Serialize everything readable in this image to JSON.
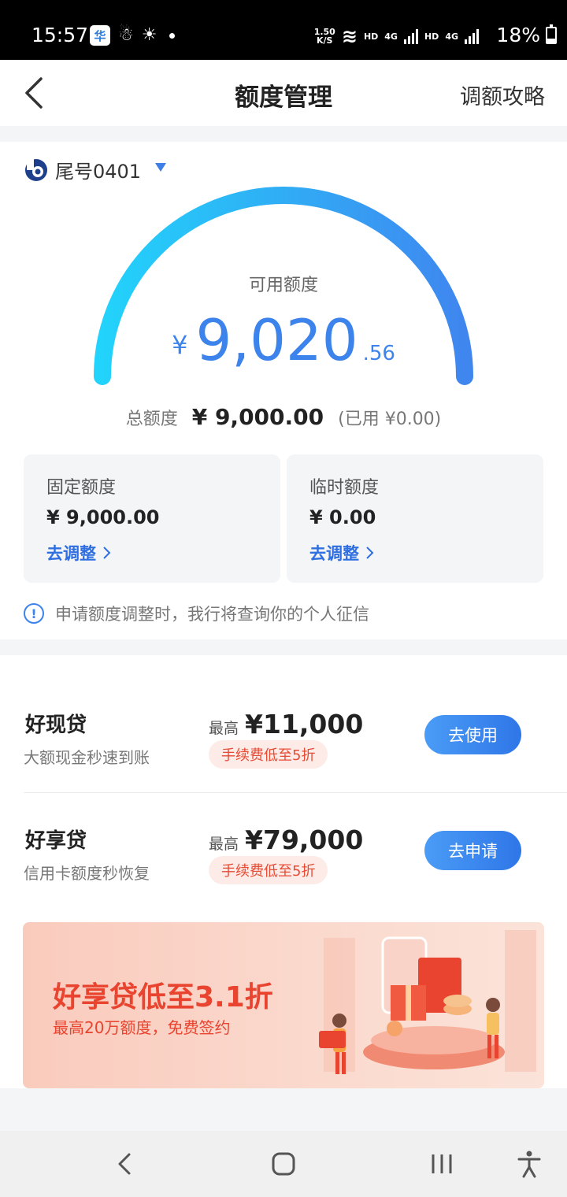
{
  "status_bar": {
    "time": "15:57",
    "app_icon_text": "华",
    "net_speed_top": "1.50",
    "net_speed_bottom": "K/S",
    "hd1": "HD",
    "net1": "4G",
    "hd2": "HD",
    "net2": "4G",
    "battery": "18%"
  },
  "header": {
    "title": "额度管理",
    "right_link": "调额攻略"
  },
  "account": {
    "label": "尾号0401"
  },
  "gauge": {
    "available_label": "可用额度",
    "currency": "¥",
    "amount_int": "9,020",
    "amount_dec": ".56",
    "colors": {
      "start": "#22d3fb",
      "end": "#3f86ef"
    }
  },
  "total": {
    "label": "总额度",
    "value": "¥ 9,000.00",
    "used": "(已用 ¥0.00)"
  },
  "quota_boxes": [
    {
      "label": "固定额度",
      "value": "¥ 9,000.00",
      "link": "去调整"
    },
    {
      "label": "临时额度",
      "value": "¥ 0.00",
      "link": "去调整"
    }
  ],
  "notice": {
    "text": "申请额度调整时，我行将查询你的个人征信"
  },
  "loans": [
    {
      "name": "好现贷",
      "subtitle": "大额现金秒速到账",
      "max_label": "最高",
      "max_value": "¥11,000",
      "tag": "手续费低至5折",
      "button": "去使用"
    },
    {
      "name": "好享贷",
      "subtitle": "信用卡额度秒恢复",
      "max_label": "最高",
      "max_value": "¥79,000",
      "tag": "手续费低至5折",
      "button": "去申请"
    }
  ],
  "banner": {
    "title": "好享贷低至3.1折",
    "subtitle": "最高20万额度，免费签约"
  },
  "colors": {
    "accent": "#3d83ec",
    "promo_red": "#e8442f"
  }
}
